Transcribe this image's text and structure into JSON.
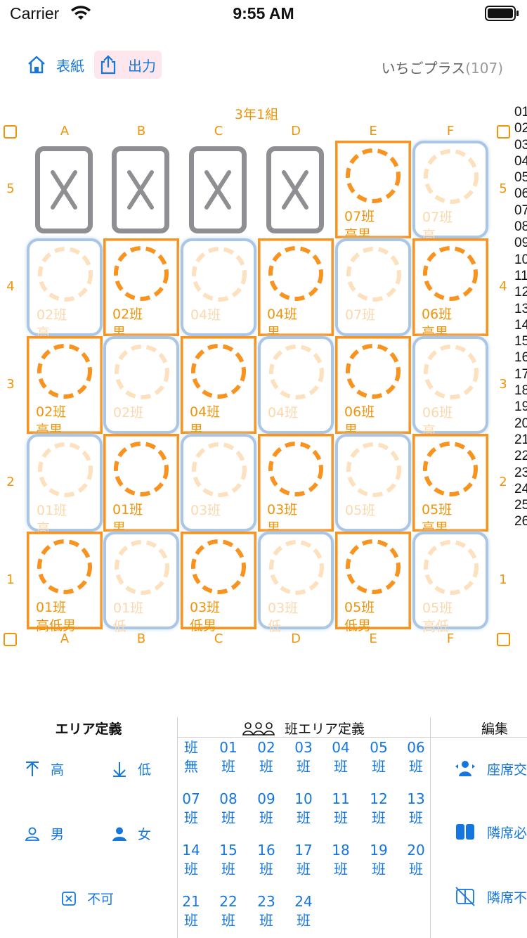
{
  "status_bar": {
    "carrier": "Carrier",
    "time": "9:55 AM"
  },
  "toolbar": {
    "home_label": "表紙",
    "export_label": "出力",
    "app_name": "いちごプラス",
    "app_count": "(107)"
  },
  "chart": {
    "title": "3年1組",
    "columns": [
      "A",
      "B",
      "C",
      "D",
      "E",
      "F"
    ],
    "rows": [
      "5",
      "4",
      "3",
      "2",
      "1"
    ],
    "seats": [
      [
        {
          "blocked": true
        },
        {
          "blocked": true
        },
        {
          "blocked": true
        },
        {
          "blocked": true
        },
        {
          "state": "on",
          "group": "07班",
          "attr": "高男"
        },
        {
          "state": "off",
          "group": "07班",
          "attr": "高"
        }
      ],
      [
        {
          "state": "off",
          "group": "02班",
          "attr": "高"
        },
        {
          "state": "on",
          "group": "02班",
          "attr": "男"
        },
        {
          "state": "off",
          "group": "04班",
          "attr": ""
        },
        {
          "state": "on",
          "group": "04班",
          "attr": "男"
        },
        {
          "state": "off",
          "group": "07班",
          "attr": ""
        },
        {
          "state": "on",
          "group": "06班",
          "attr": "高男"
        }
      ],
      [
        {
          "state": "on",
          "group": "02班",
          "attr": "高男"
        },
        {
          "state": "off",
          "group": "02班",
          "attr": ""
        },
        {
          "state": "on",
          "group": "04班",
          "attr": "男"
        },
        {
          "state": "off",
          "group": "04班",
          "attr": ""
        },
        {
          "state": "on",
          "group": "06班",
          "attr": "男"
        },
        {
          "state": "off",
          "group": "06班",
          "attr": "高"
        }
      ],
      [
        {
          "state": "off",
          "group": "01班",
          "attr": "高"
        },
        {
          "state": "on",
          "group": "01班",
          "attr": "男"
        },
        {
          "state": "off",
          "group": "03班",
          "attr": ""
        },
        {
          "state": "on",
          "group": "03班",
          "attr": "男"
        },
        {
          "state": "off",
          "group": "05班",
          "attr": ""
        },
        {
          "state": "on",
          "group": "05班",
          "attr": "高男"
        }
      ],
      [
        {
          "state": "on",
          "group": "01班",
          "attr": "高低男"
        },
        {
          "state": "off",
          "group": "01班",
          "attr": "低"
        },
        {
          "state": "on",
          "group": "03班",
          "attr": "低男"
        },
        {
          "state": "off",
          "group": "03班",
          "attr": "低"
        },
        {
          "state": "on",
          "group": "05班",
          "attr": "低男"
        },
        {
          "state": "off",
          "group": "05班",
          "attr": "高低"
        }
      ]
    ],
    "number_list": [
      "01",
      "02",
      "03",
      "04",
      "05",
      "06",
      "07",
      "08",
      "09",
      "10",
      "11",
      "12",
      "13",
      "14",
      "15",
      "16",
      "17",
      "18",
      "19",
      "20",
      "21",
      "22",
      "23",
      "24",
      "25",
      "26"
    ]
  },
  "area_panel": {
    "title": "エリア定義",
    "high": "高",
    "low": "低",
    "male": "男",
    "female": "女",
    "disabled": "不可"
  },
  "groups_panel": {
    "title": "班エリア定義",
    "buttons": [
      [
        "班",
        "無"
      ],
      [
        "01",
        "班"
      ],
      [
        "02",
        "班"
      ],
      [
        "03",
        "班"
      ],
      [
        "04",
        "班"
      ],
      [
        "05",
        "班"
      ],
      [
        "06",
        "班"
      ],
      [
        "07",
        "班"
      ],
      [
        "08",
        "班"
      ],
      [
        "09",
        "班"
      ],
      [
        "10",
        "班"
      ],
      [
        "11",
        "班"
      ],
      [
        "12",
        "班"
      ],
      [
        "13",
        "班"
      ],
      [
        "14",
        "班"
      ],
      [
        "15",
        "班"
      ],
      [
        "16",
        "班"
      ],
      [
        "17",
        "班"
      ],
      [
        "18",
        "班"
      ],
      [
        "19",
        "班"
      ],
      [
        "20",
        "班"
      ],
      [
        "21",
        "班"
      ],
      [
        "22",
        "班"
      ],
      [
        "23",
        "班"
      ],
      [
        "24",
        "班"
      ]
    ]
  },
  "edit_panel": {
    "title": "編集",
    "swap": "座席交",
    "adjacent_required": "隣席必",
    "adjacent_forbidden": "隣席不"
  },
  "colors": {
    "accent_orange": "#f7931e",
    "link_blue": "#1476de",
    "blocked_gray": "#8f8f93",
    "off_border": "#a9c6e6"
  }
}
